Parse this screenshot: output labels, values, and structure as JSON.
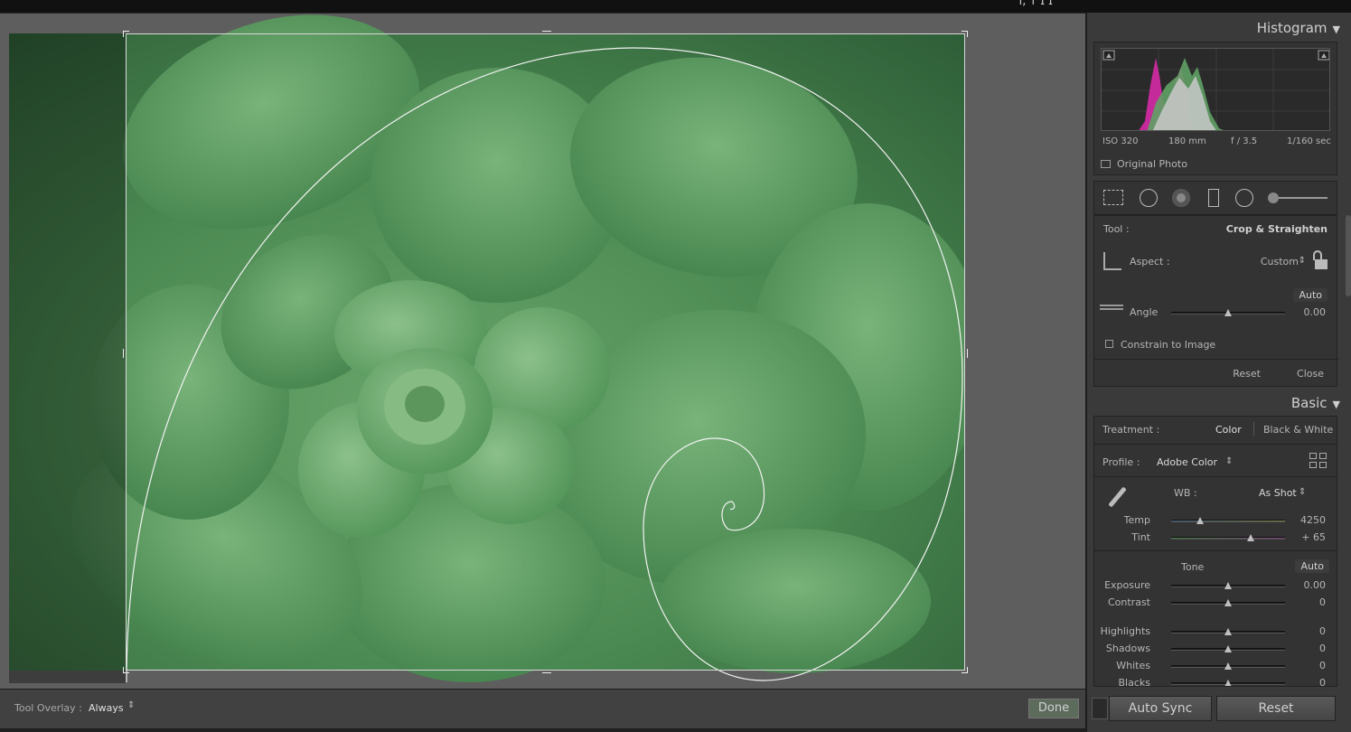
{
  "topbar": {
    "text": "ı, ᴛ ɪ ɪ"
  },
  "canvas": {
    "tool_overlay_label": "Tool Overlay :",
    "tool_overlay_value": "Always",
    "done_label": "Done"
  },
  "histogram": {
    "title": "Histogram",
    "iso": "ISO 320",
    "focal": "180 mm",
    "aperture": "f / 3.5",
    "shutter": "1/160 sec",
    "original_photo": "Original Photo"
  },
  "tools": {
    "icons": [
      "crop-overlay-icon",
      "spot-removal-icon",
      "red-eye-icon",
      "graduated-filter-icon",
      "radial-filter-icon",
      "adjustment-brush-icon"
    ]
  },
  "crop": {
    "tool_label": "Tool :",
    "tool_value": "Crop & Straighten",
    "aspect_label": "Aspect :",
    "aspect_value": "Custom",
    "auto_label": "Auto",
    "angle_label": "Angle",
    "angle_value": "0.00",
    "angle_fraction": 0.5,
    "constrain_label": "Constrain to Image",
    "reset_label": "Reset",
    "close_label": "Close"
  },
  "basic": {
    "title": "Basic",
    "treatment_label": "Treatment :",
    "treatment_color": "Color",
    "treatment_bw": "Black & White",
    "profile_label": "Profile :",
    "profile_value": "Adobe Color",
    "wb_label": "WB :",
    "wb_value": "As Shot",
    "tone_label": "Tone",
    "tone_auto": "Auto",
    "sliders": [
      {
        "label": "Temp",
        "value": "4250",
        "fraction": 0.25
      },
      {
        "label": "Tint",
        "value": "+ 65",
        "fraction": 0.7
      },
      {
        "label": "Exposure",
        "value": "0.00",
        "fraction": 0.5
      },
      {
        "label": "Contrast",
        "value": "0",
        "fraction": 0.5
      },
      {
        "label": "Highlights",
        "value": "0",
        "fraction": 0.5
      },
      {
        "label": "Shadows",
        "value": "0",
        "fraction": 0.5
      },
      {
        "label": "Whites",
        "value": "0",
        "fraction": 0.5
      },
      {
        "label": "Blacks",
        "value": "0",
        "fraction": 0.5
      }
    ]
  },
  "footer": {
    "auto_sync_label": "Auto Sync",
    "reset_label": "Reset"
  },
  "colors": {
    "panel_bg": "#3a3a3a",
    "canvas_bg": "#5e5e5e",
    "leaf_green": "#5e9a5f"
  }
}
